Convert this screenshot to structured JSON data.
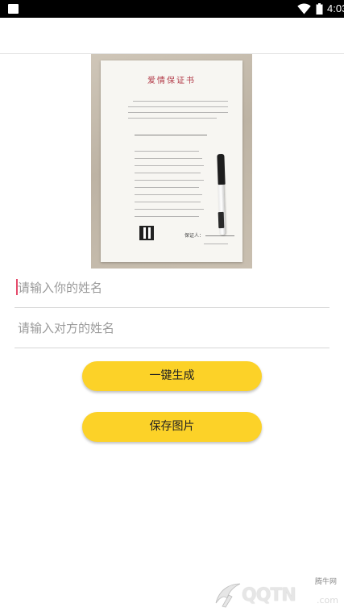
{
  "status_bar": {
    "time": "4:03",
    "icons": [
      "notification-icon",
      "wifi-icon",
      "battery-icon"
    ]
  },
  "certificate_image": {
    "title": "爱情保证书",
    "signature_line": "保证人：",
    "description_icon": "certificate-photo"
  },
  "form": {
    "your_name_placeholder": "请输入你的姓名",
    "their_name_placeholder": "请输入对方的姓名",
    "your_name_value": "",
    "their_name_value": ""
  },
  "actions": {
    "generate_label": "一键生成",
    "save_label": "保存图片"
  },
  "watermark": {
    "logo_text": "QQTN",
    "site_name": "腾牛网",
    "domain": ".com"
  },
  "colors": {
    "accent": "#fcd228",
    "status_bar": "#000000",
    "caret": "#e54a6a",
    "title_red": "#b23a48"
  }
}
